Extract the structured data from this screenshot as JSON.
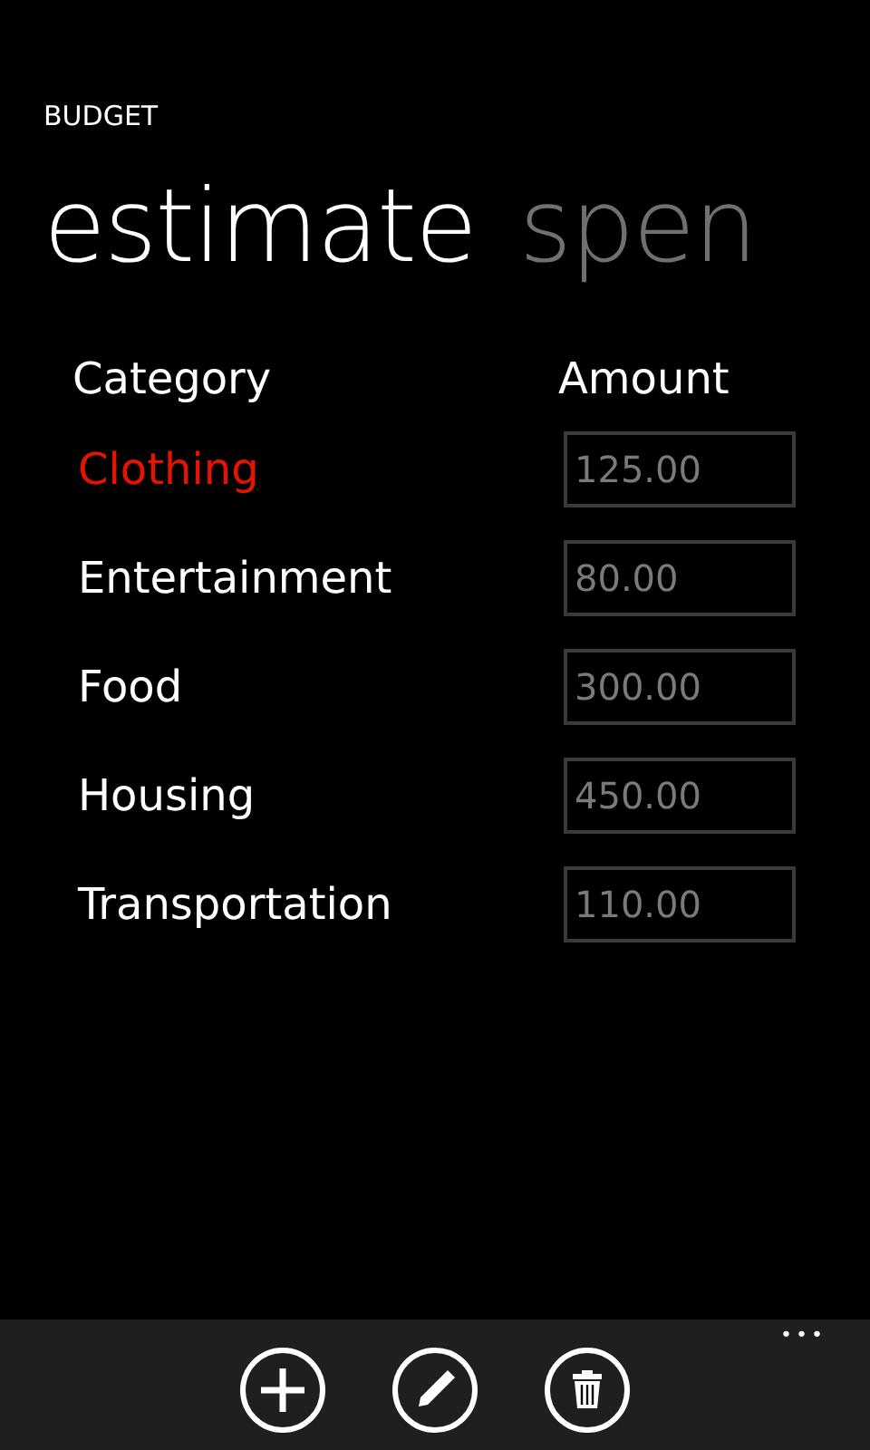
{
  "app_title": "BUDGET",
  "pivot": [
    {
      "label": "estimate",
      "selected": true
    },
    {
      "label": "spen",
      "selected": false
    }
  ],
  "table": {
    "columns": [
      "Category",
      "Amount"
    ],
    "rows": [
      {
        "category": "Clothing",
        "amount": "125.00",
        "selected": true
      },
      {
        "category": "Entertainment",
        "amount": "80.00",
        "selected": false
      },
      {
        "category": "Food",
        "amount": "300.00",
        "selected": false
      },
      {
        "category": "Housing",
        "amount": "450.00",
        "selected": false
      },
      {
        "category": "Transportation",
        "amount": "110.00",
        "selected": false
      }
    ]
  },
  "app_bar": {
    "buttons": [
      {
        "kind": "add"
      },
      {
        "kind": "edit"
      },
      {
        "kind": "delete"
      }
    ],
    "more": "•••"
  }
}
